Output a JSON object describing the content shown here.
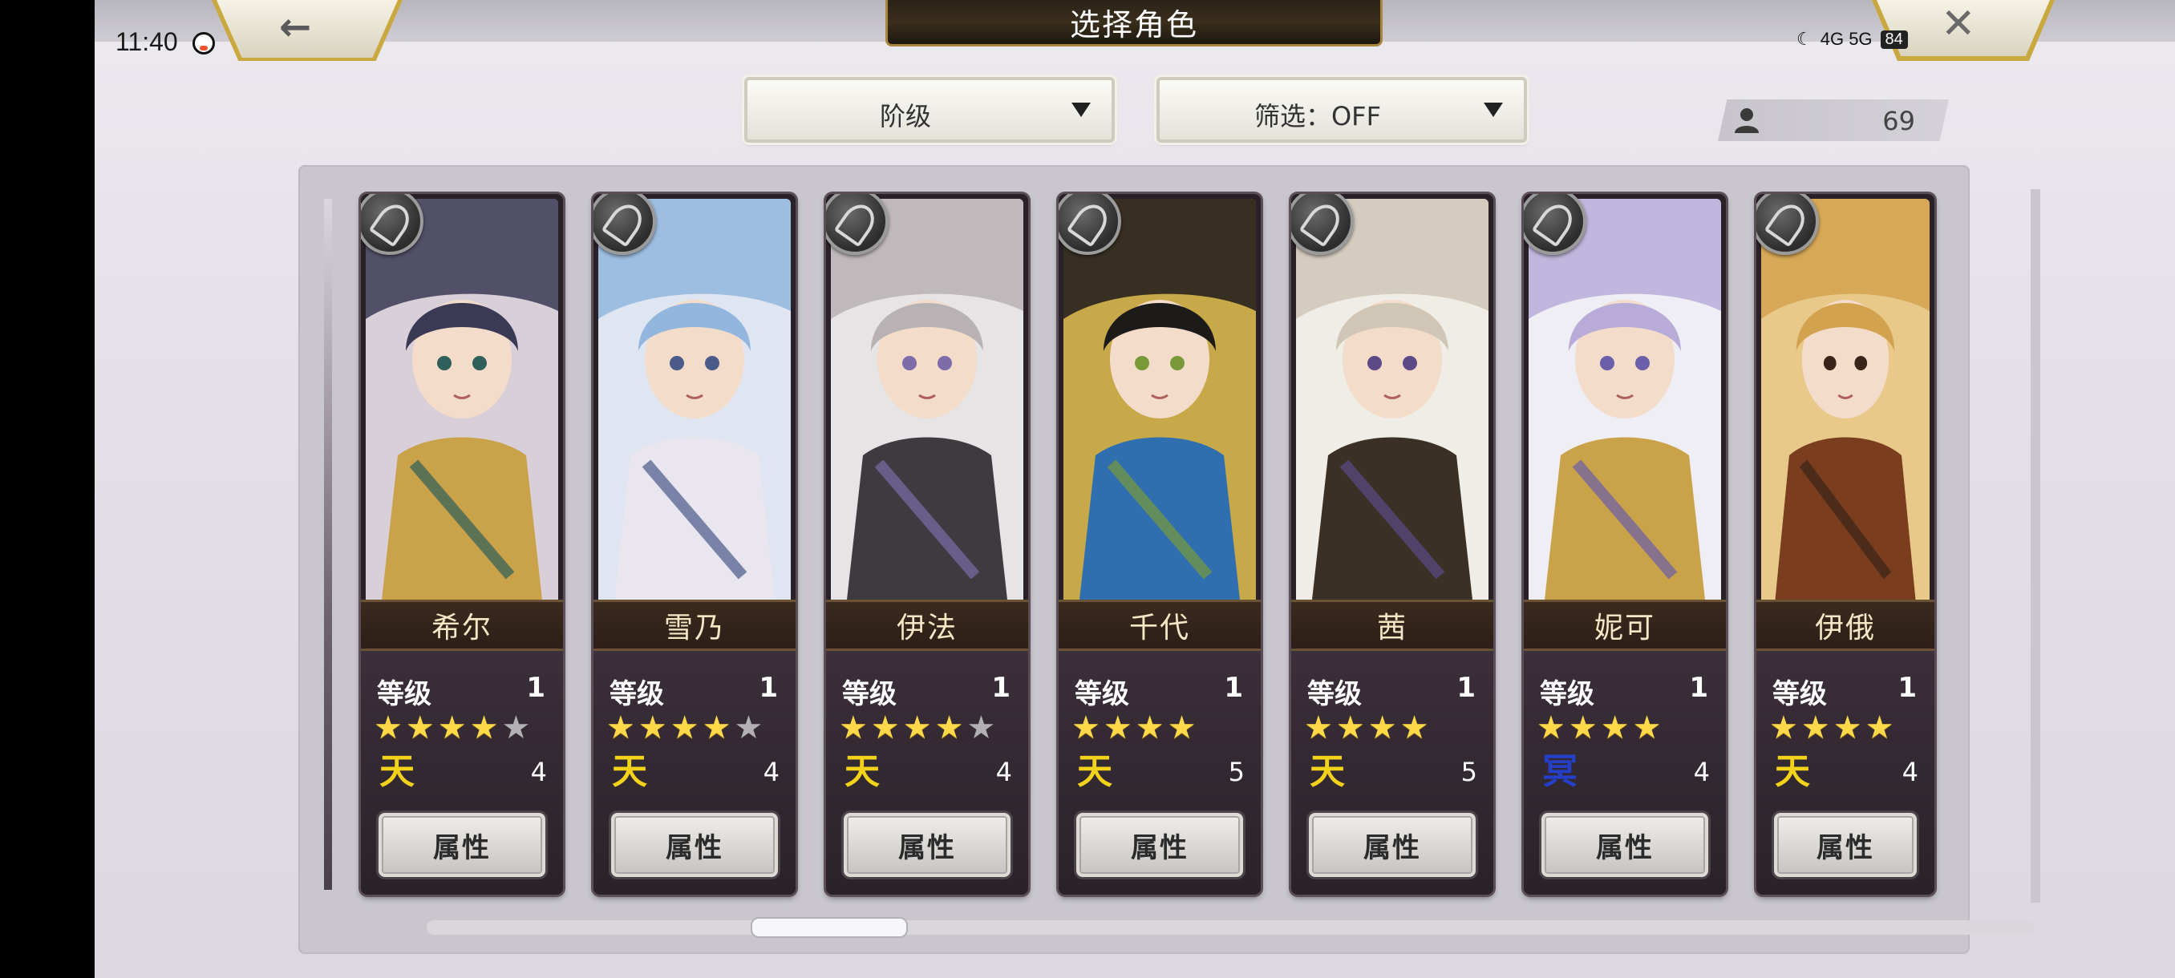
{
  "status_bar": {
    "time": "11:40",
    "right_indicators": "4G 5G",
    "battery": "84"
  },
  "header": {
    "title": "选择角色",
    "back_icon": "back-arrow-icon",
    "close_icon": "close-icon"
  },
  "filters": {
    "sort_label": "阶级",
    "filter_label": "筛选：OFF"
  },
  "roster_count": "69",
  "characters": [
    {
      "name": "希尔",
      "level_label": "等级",
      "level": "1",
      "stars": 4,
      "max_stars": 5,
      "rank_glyph": "天",
      "rank_color": "#f2d21a",
      "rank_num": "4",
      "attr_label": "属性",
      "palette": [
        "#d9cfd8",
        "#3a3a55",
        "#c9a24a",
        "#2e5f5a"
      ]
    },
    {
      "name": "雪乃",
      "level_label": "等级",
      "level": "1",
      "stars": 4,
      "max_stars": 5,
      "rank_glyph": "天",
      "rank_color": "#f2d21a",
      "rank_num": "4",
      "attr_label": "属性",
      "palette": [
        "#dfe6f2",
        "#93b6de",
        "#e9e6ef",
        "#4a5a8a"
      ]
    },
    {
      "name": "伊法",
      "level_label": "等级",
      "level": "1",
      "stars": 4,
      "max_stars": 5,
      "rank_glyph": "天",
      "rank_color": "#f2d21a",
      "rank_num": "4",
      "attr_label": "属性",
      "palette": [
        "#e7e4e6",
        "#b9b2b4",
        "#3d3a40",
        "#7c6ca8"
      ]
    },
    {
      "name": "千代",
      "level_label": "等级",
      "level": "1",
      "stars": 4,
      "max_stars": 4,
      "rank_glyph": "天",
      "rank_color": "#f2d21a",
      "rank_num": "5",
      "attr_label": "属性",
      "palette": [
        "#c8a94a",
        "#1d1a1a",
        "#2f6fb0",
        "#7a9a3a"
      ]
    },
    {
      "name": "茜",
      "level_label": "等级",
      "level": "1",
      "stars": 4,
      "max_stars": 4,
      "rank_glyph": "天",
      "rank_color": "#f2d21a",
      "rank_num": "5",
      "attr_label": "属性",
      "palette": [
        "#f0ede6",
        "#cfc6b6",
        "#3a3026",
        "#5b4a86"
      ]
    },
    {
      "name": "妮可",
      "level_label": "等级",
      "level": "1",
      "stars": 4,
      "max_stars": 4,
      "rank_glyph": "冥",
      "rank_color": "#2540c8",
      "rank_num": "4",
      "attr_label": "属性",
      "palette": [
        "#eeeef4",
        "#b9abd8",
        "#c9a24a",
        "#6a5fa8"
      ]
    },
    {
      "name": "伊俄",
      "level_label": "等级",
      "level": "1",
      "stars": 4,
      "max_stars": 4,
      "rank_glyph": "天",
      "rank_color": "#f2d21a",
      "rank_num": "4",
      "attr_label": "属性",
      "palette": [
        "#e8c98a",
        "#d3a24e",
        "#7a3e1e",
        "#3a241a"
      ]
    }
  ],
  "scrollbar": {
    "position_fraction": 0.12
  }
}
